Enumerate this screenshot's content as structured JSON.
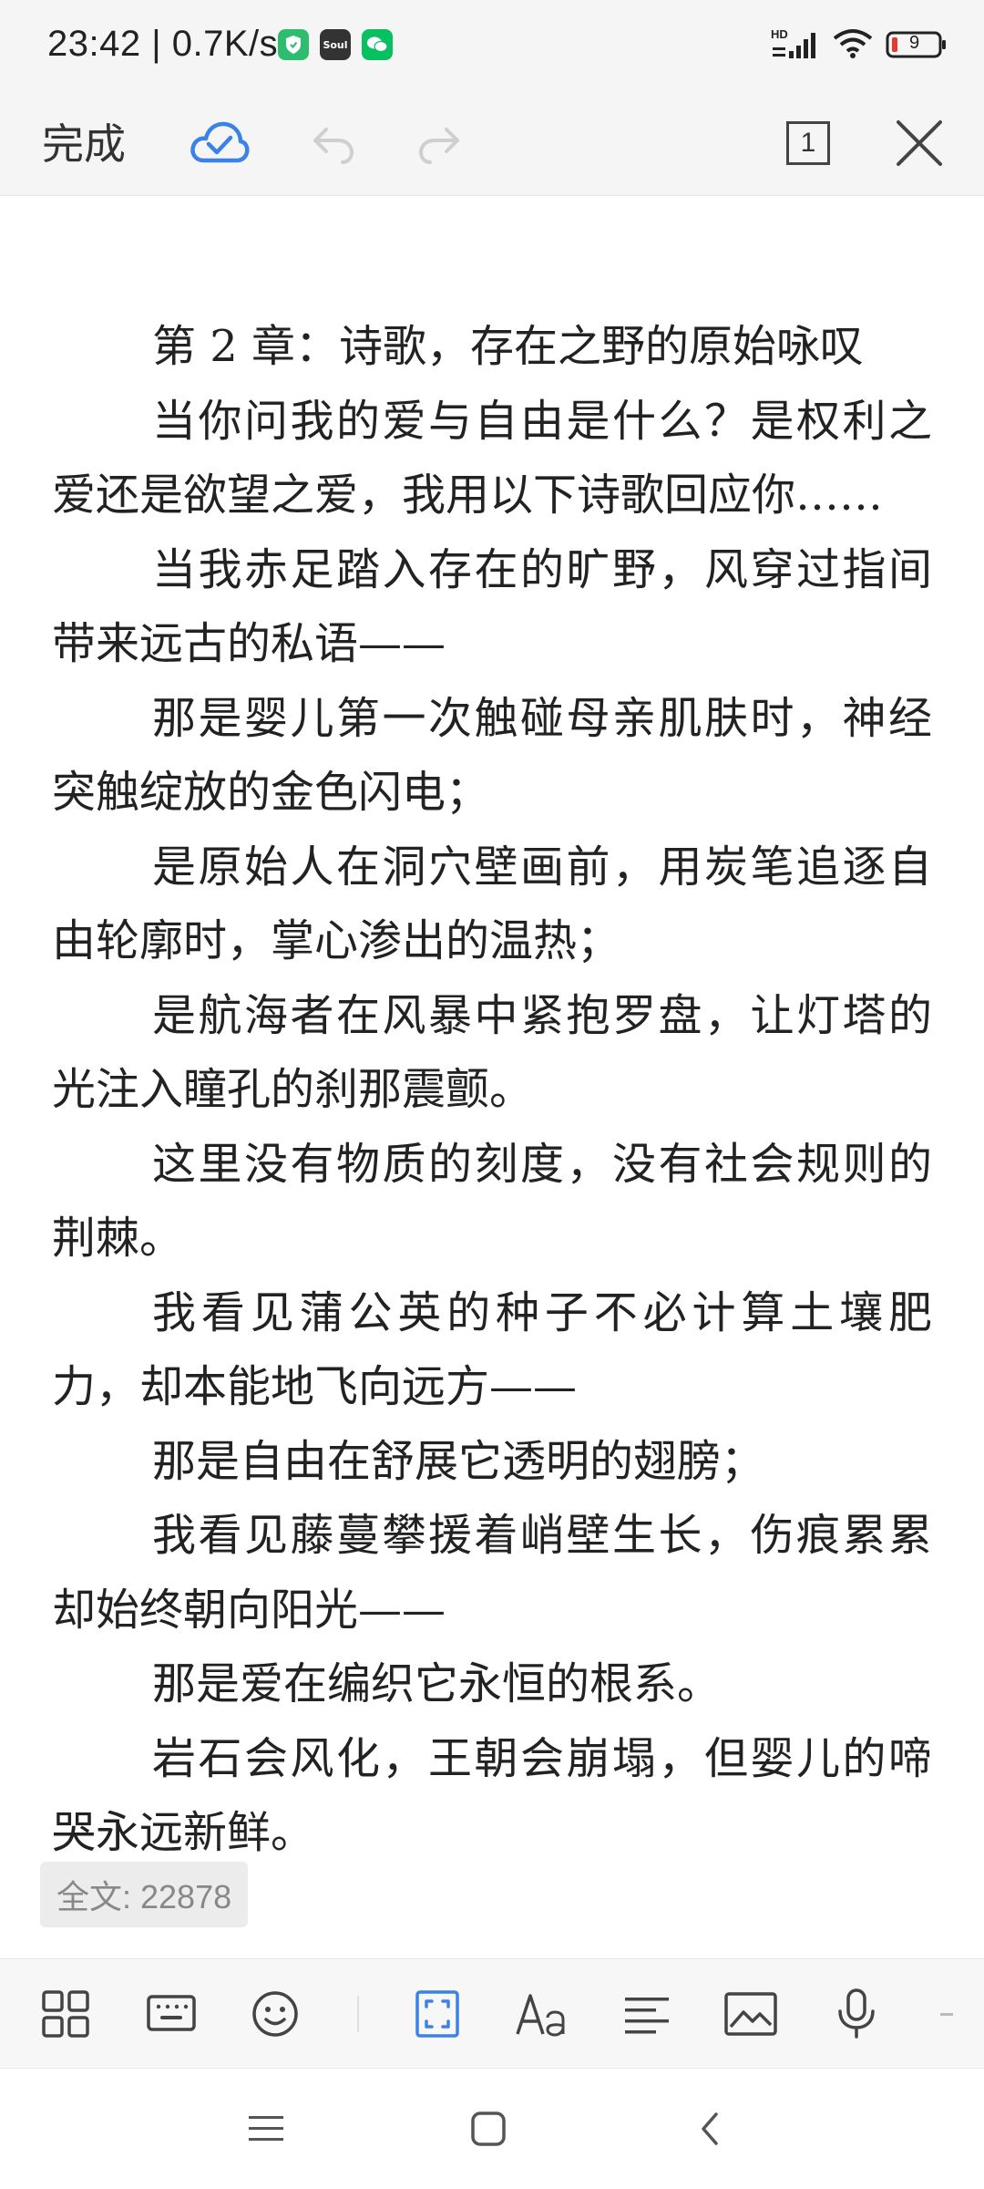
{
  "status_bar": {
    "time": "23:42",
    "speed": "0.7K/s",
    "apps": [
      "shield-app-icon",
      "soul-app-icon",
      "wechat-app-icon"
    ],
    "soul_label": "Soul",
    "network_label": "HD",
    "battery": "9"
  },
  "toolbar": {
    "done_label": "完成",
    "page_count": "1",
    "accent": "#3b82e6"
  },
  "document": {
    "paragraphs": [
      "第 2 章：诗歌，存在之野的原始咏叹",
      "当你问我的爱与自由是什么？是权利之爱还是欲望之爱，我用以下诗歌回应你……",
      "当我赤足踏入存在的旷野，风穿过指间带来远古的私语——",
      "那是婴儿第一次触碰母亲肌肤时，神经突触绽放的金色闪电；",
      "是原始人在洞穴壁画前，用炭笔追逐自由轮廓时，掌心渗出的温热；",
      "是航海者在风暴中紧抱罗盘，让灯塔的光注入瞳孔的刹那震颤。",
      "这里没有物质的刻度，没有社会规则的荆棘。",
      "我看见蒲公英的种子不必计算土壤肥力，却本能地飞向远方——",
      "那是自由在舒展它透明的翅膀；",
      "我看见藤蔓攀援着峭壁生长，伤痕累累却始终朝向阳光——",
      "那是爱在编织它永恒的根系。",
      "岩石会风化，王朝会崩塌，但婴儿的啼哭永远新鲜。"
    ]
  },
  "word_count": "全文: 22878",
  "bottom_toolbar": {
    "items": [
      "apps-icon",
      "keyboard-icon",
      "emoji-icon",
      "fullscreen-icon",
      "font-icon",
      "align-icon",
      "image-icon",
      "microphone-icon",
      "more-icon"
    ]
  },
  "nav_bar": {
    "items": [
      "menu-icon",
      "home-icon",
      "back-icon"
    ]
  }
}
